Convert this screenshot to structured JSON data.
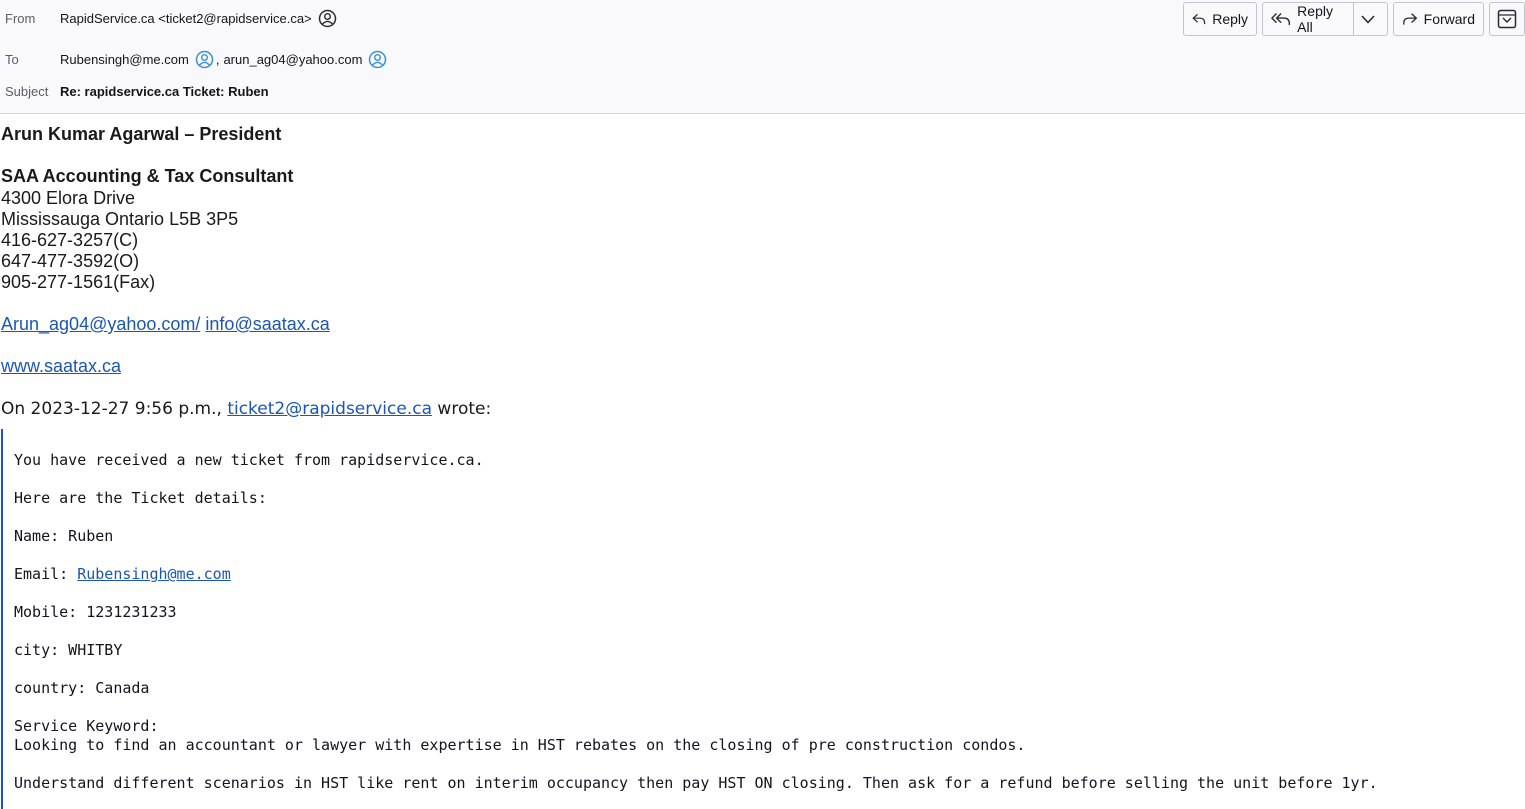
{
  "header": {
    "from_label": "From",
    "from_value": "RapidService.ca <ticket2@rapidservice.ca>",
    "to_label": "To",
    "to_recipients": [
      "Rubensingh@me.com",
      "arun_ag04@yahoo.com"
    ],
    "to_separator": ",",
    "subject_label": "Subject",
    "subject_value": "Re: rapidservice.ca Ticket: Ruben"
  },
  "toolbar": {
    "reply_label": "Reply",
    "reply_all_label": "Reply All",
    "forward_label": "Forward"
  },
  "signature": {
    "name_title": "Arun Kumar Agarwal – President",
    "company": "SAA Accounting & Tax Consultant",
    "address_line1": "4300 Elora Drive",
    "address_line2": "Mississauga Ontario L5B 3P5",
    "phone_cell": "416-627-3257(C)",
    "phone_office": "647-477-3592(O)",
    "fax": "905-277-1561(Fax)",
    "email1": "Arun_ag04@yahoo.com/",
    "email2": "info@saatax.ca",
    "website": "www.saatax.ca"
  },
  "attribution": {
    "prefix": "On 2023-12-27 9:56 p.m.,",
    "sender_link": "ticket2@rapidservice.ca",
    "suffix": "wrote:"
  },
  "quote": {
    "intro": "You have received a new ticket from rapidservice.ca.",
    "details_heading": "Here are the Ticket details:",
    "name": "Name: Ruben",
    "email_label": "Email:",
    "email_link": "Rubensingh@me.com",
    "mobile": "Mobile: 1231231233",
    "city": "city: WHITBY",
    "country": "country: Canada",
    "service_keyword_label": "Service Keyword:",
    "service_line1": "Looking to find an accountant or lawyer with expertise in HST rebates on the closing of pre construction condos.",
    "service_line2": "Understand different scenarios in HST like rent on interim occupancy then pay HST ON closing. Then ask for a refund before selling the unit before 1yr."
  },
  "colors": {
    "link": "#1a56b8",
    "header_bg": "#f9f9fb"
  }
}
